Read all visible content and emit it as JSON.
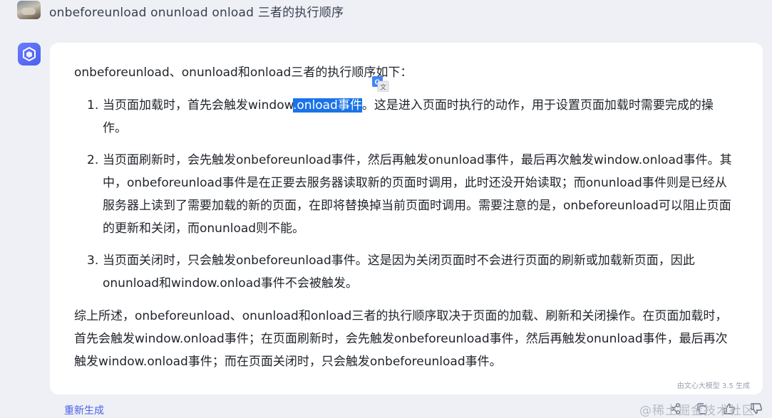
{
  "question": {
    "text": "onbeforeunload  onunload onload 三者的执行顺序"
  },
  "answer": {
    "intro": "onbeforeunload、onunload和onload三者的执行顺序如下：",
    "items": [
      {
        "num": "1.",
        "pre": "当页面加载时，首先会触发window",
        "highlight": ".onload事件",
        "post": "。这是进入页面时执行的动作，用于设置页面加载时需要完成的操作。"
      },
      {
        "num": "2.",
        "text": "当页面刷新时，会先触发onbeforeunload事件，然后再触发onunload事件，最后再次触发window.onload事件。其中，onbeforeunload事件是在正要去服务器读取新的页面时调用，此时还没开始读取；而onunload事件则是已经从服务器上读到了需要加载的新的页面，在即将替换掉当前页面时调用。需要注意的是，onbeforeunload可以阻止页面的更新和关闭，而onunload则不能。"
      },
      {
        "num": "3.",
        "text": "当页面关闭时，只会触发onbeforeunload事件。这是因为关闭页面时不会进行页面的刷新或加载新页面，因此onunload和window.onload事件不会被触发。"
      }
    ],
    "summary": "综上所述，onbeforeunload、onunload和onload三者的执行顺序取决于页面的加载、刷新和关闭操作。在页面加载时，首先会触发window.onload事件；在页面刷新时，会先触发onbeforeunload事件，然后再触发onunload事件，最后再次触发window.onload事件；而在页面关闭时，只会触发onbeforeunload事件。",
    "generated_by": "由文心大模型 3.5 生成"
  },
  "footer": {
    "regenerate_label": "重新生成",
    "site_watermark": "@稀土掘金技术社区"
  },
  "colors": {
    "accent": "#4a62e8",
    "highlight": "#1a73e8",
    "background": "#eef0f6"
  },
  "icons": [
    "share-icon",
    "copy-icon",
    "thumbs-up-icon",
    "thumbs-down-icon",
    "google-translate-icon",
    "ernie-logo-icon"
  ]
}
